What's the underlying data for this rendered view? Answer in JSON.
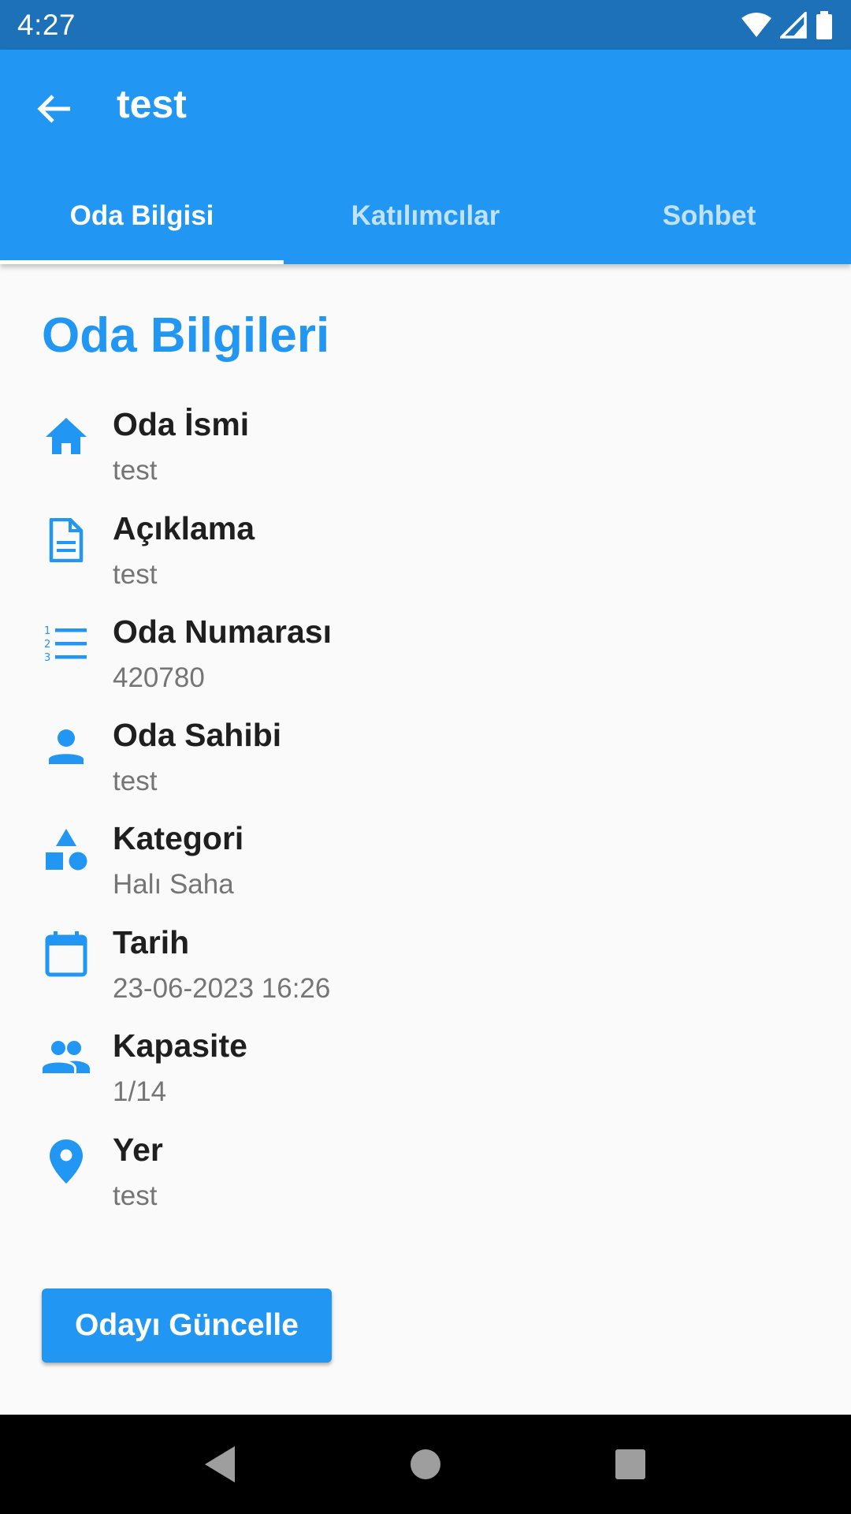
{
  "status_bar": {
    "time": "4:27"
  },
  "app_bar": {
    "title": "test"
  },
  "tabs": [
    {
      "label": "Oda Bilgisi",
      "active": true
    },
    {
      "label": "Katılımcılar",
      "active": false
    },
    {
      "label": "Sohbet",
      "active": false
    }
  ],
  "section_title": "Oda Bilgileri",
  "info_items": [
    {
      "icon": "home-icon",
      "label": "Oda İsmi",
      "value": "test"
    },
    {
      "icon": "document-icon",
      "label": "Açıklama",
      "value": "test"
    },
    {
      "icon": "numbered-list-icon",
      "label": "Oda Numarası",
      "value": "420780"
    },
    {
      "icon": "person-icon",
      "label": "Oda Sahibi",
      "value": "test"
    },
    {
      "icon": "category-icon",
      "label": "Kategori",
      "value": "Halı Saha"
    },
    {
      "icon": "calendar-icon",
      "label": "Tarih",
      "value": "23-06-2023 16:26"
    },
    {
      "icon": "people-icon",
      "label": "Kapasite",
      "value": "1/14"
    },
    {
      "icon": "location-pin-icon",
      "label": "Yer",
      "value": "test"
    }
  ],
  "update_button_label": "Odayı Güncelle",
  "colors": {
    "primary": "#2196f3",
    "status_bar": "#1c71b8",
    "background": "#fafafa"
  }
}
